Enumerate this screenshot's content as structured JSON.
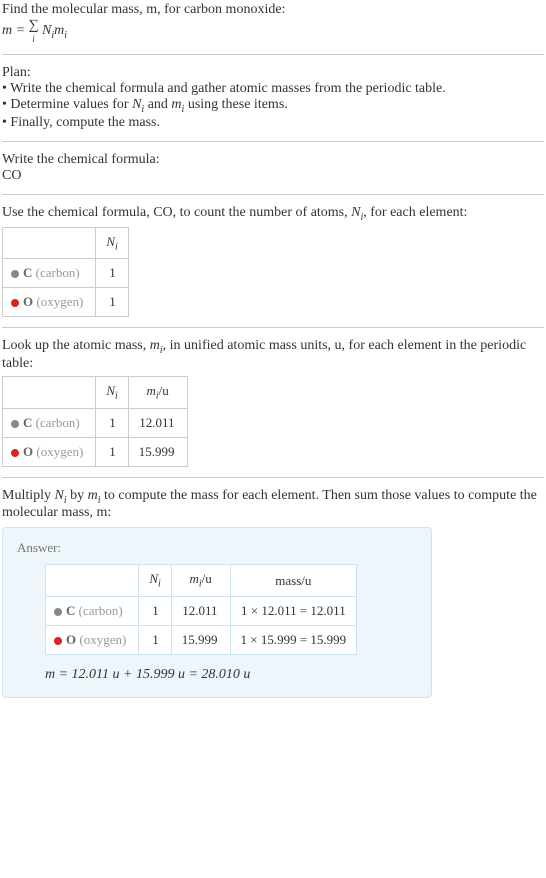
{
  "intro": {
    "line1": "Find the molecular mass, m, for carbon monoxide:",
    "eq_lhs": "m = ",
    "eq_rhs_n": "N",
    "eq_rhs_m": "m",
    "sigma_sub": "i"
  },
  "plan": {
    "title": "Plan:",
    "b1": "• Write the chemical formula and gather atomic masses from the periodic table.",
    "b2_a": "• Determine values for ",
    "b2_ni": "N",
    "b2_and": " and ",
    "b2_mi": "m",
    "b2_end": " using these items.",
    "b3": "• Finally, compute the mass."
  },
  "step1": {
    "title": "Write the chemical formula:",
    "formula": "CO"
  },
  "step2": {
    "text_a": "Use the chemical formula, CO, to count the number of atoms, ",
    "text_ni": "N",
    "text_b": ", for each element:",
    "header_ni": "N",
    "rows": [
      {
        "sym": "C",
        "name": "(carbon)",
        "ni": "1"
      },
      {
        "sym": "O",
        "name": "(oxygen)",
        "ni": "1"
      }
    ]
  },
  "step3": {
    "text_a": "Look up the atomic mass, ",
    "text_mi": "m",
    "text_b": ", in unified atomic mass units, u, for each element in the periodic table:",
    "header_ni": "N",
    "header_mi": "m",
    "header_mi_unit": "/u",
    "rows": [
      {
        "sym": "C",
        "name": "(carbon)",
        "ni": "1",
        "mi": "12.011"
      },
      {
        "sym": "O",
        "name": "(oxygen)",
        "ni": "1",
        "mi": "15.999"
      }
    ]
  },
  "step4": {
    "text_a": "Multiply ",
    "text_ni": "N",
    "text_by": " by ",
    "text_mi": "m",
    "text_b": " to compute the mass for each element. Then sum those values to compute the molecular mass, m:"
  },
  "answer": {
    "label": "Answer:",
    "header_ni": "N",
    "header_mi": "m",
    "header_mi_unit": "/u",
    "header_mass": "mass/u",
    "rows": [
      {
        "sym": "C",
        "name": "(carbon)",
        "ni": "1",
        "mi": "12.011",
        "mass": "1 × 12.011 = 12.011"
      },
      {
        "sym": "O",
        "name": "(oxygen)",
        "ni": "1",
        "mi": "15.999",
        "mass": "1 × 15.999 = 15.999"
      }
    ],
    "final": "m = 12.011 u + 15.999 u = 28.010 u"
  },
  "i": "i"
}
